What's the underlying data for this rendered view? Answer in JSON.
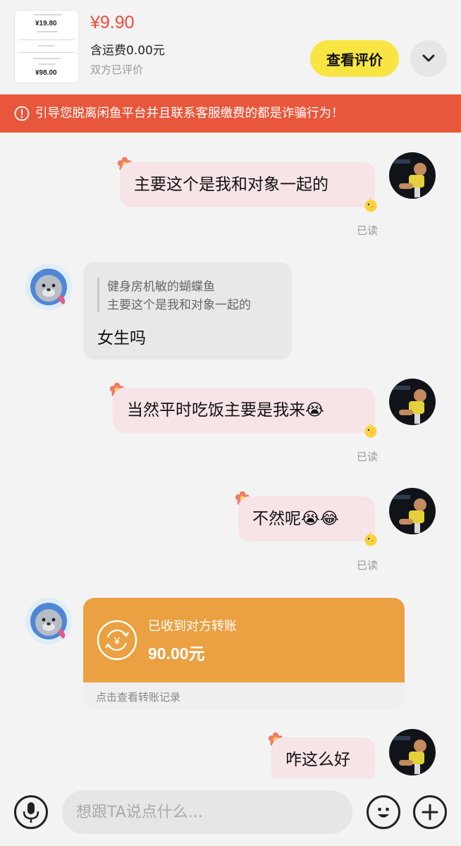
{
  "header": {
    "product_thumb": {
      "price_a": "¥19.80",
      "price_b": "¥98.00"
    },
    "price": "¥9.90",
    "shipping": "含运费0.00元",
    "status": "双方已评价",
    "review_button": "查看评价",
    "collapse_icon": "chevron-down-icon"
  },
  "banner": {
    "icon": "warning-circle-icon",
    "text": "引导您脱离闲鱼平台并且联系客服缴费的都是诈骗行为！"
  },
  "messages": [
    {
      "side": "right",
      "text": "主要这个是我和对象一起的",
      "status": "已读"
    },
    {
      "side": "left",
      "quote_name": "健身房机敏的蝴蝶鱼",
      "quote_text": "主要这个是我和对象一起的",
      "text": "女生吗"
    },
    {
      "side": "right",
      "text": "当然平时吃饭主要是我来😭",
      "status": "已读"
    },
    {
      "side": "right",
      "text": "不然呢😭😂",
      "status": "已读"
    },
    {
      "side": "left",
      "type": "transfer",
      "title": "已收到对方转账",
      "amount": "90.00元",
      "footer": "点击查看转账记录"
    },
    {
      "side": "right",
      "text": "咋这么好"
    }
  ],
  "input_bar": {
    "voice_icon": "microphone-icon",
    "placeholder": "想跟TA说点什么...",
    "emoji_icon": "smile-icon",
    "plus_icon": "plus-icon"
  },
  "colors": {
    "price": "#f14c3a",
    "banner": "#e8573b",
    "review_button": "#f8e544",
    "bubble_self": "#f6e4e6",
    "bubble_other": "#e8e8e8",
    "transfer": "#eba041"
  }
}
